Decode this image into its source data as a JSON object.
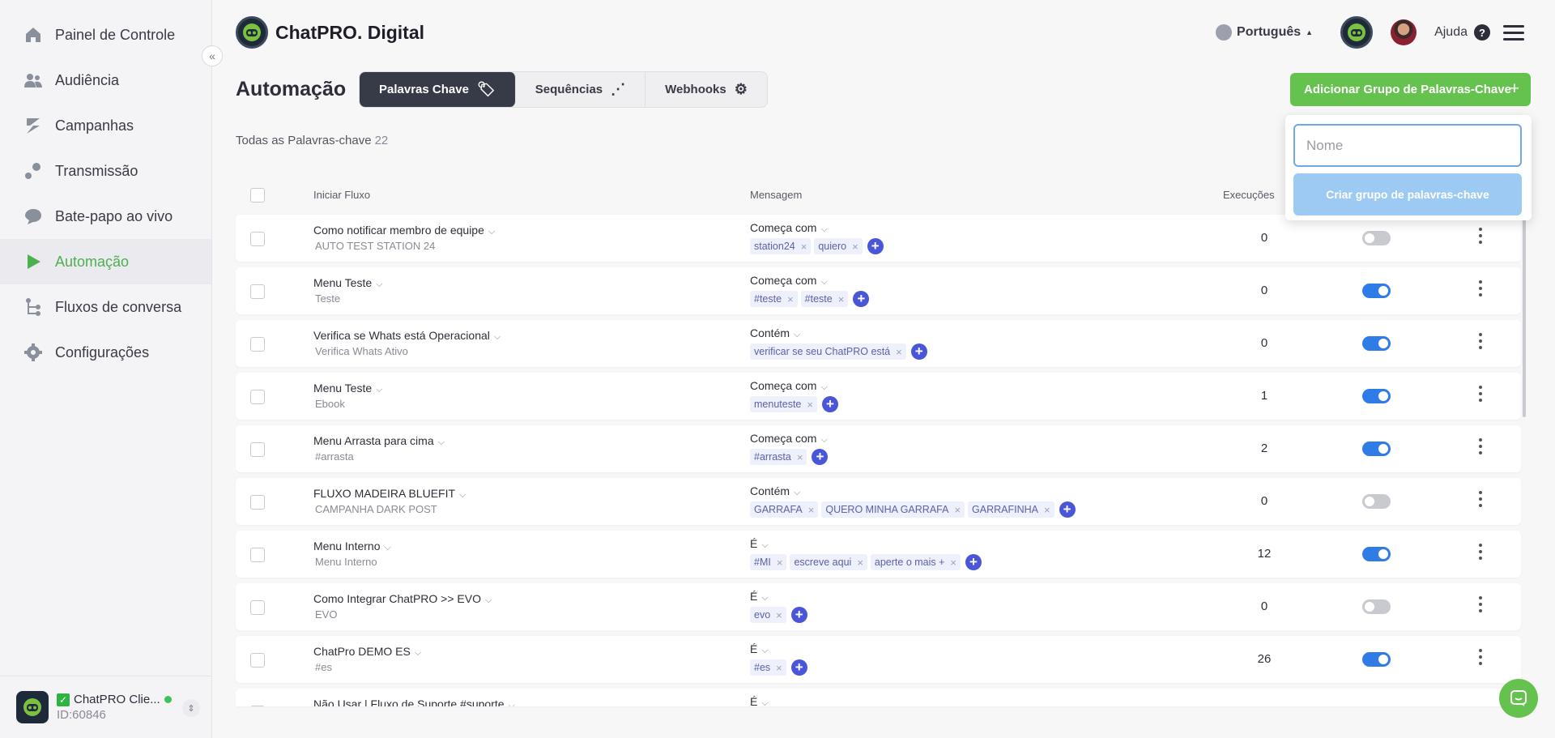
{
  "sidebar": {
    "items": [
      {
        "label": "Painel de Controle",
        "icon": "home-icon"
      },
      {
        "label": "Audiência",
        "icon": "users-icon"
      },
      {
        "label": "Campanhas",
        "icon": "campaigns-icon"
      },
      {
        "label": "Transmissão",
        "icon": "broadcast-icon"
      },
      {
        "label": "Bate-papo ao vivo",
        "icon": "chat-bubble-icon"
      },
      {
        "label": "Automação",
        "icon": "play-icon",
        "active": true
      },
      {
        "label": "Fluxos de conversa",
        "icon": "flow-icon"
      },
      {
        "label": "Configurações",
        "icon": "gear-icon"
      }
    ],
    "collapse_glyph": "«",
    "account": {
      "name": "ChatPRO Clie...",
      "id": "ID:60846",
      "check": "✓"
    }
  },
  "header": {
    "brand": "ChatPRO. Digital",
    "language": "Português",
    "help": "Ajuda",
    "help_glyph": "?"
  },
  "page": {
    "title": "Automação",
    "tabs": [
      {
        "label": "Palavras Chave",
        "icon": "tag-icon",
        "active": true
      },
      {
        "label": "Sequências",
        "icon": "sequence-icon"
      },
      {
        "label": "Webhooks",
        "icon": "webhook-icon"
      }
    ],
    "add_button": "Adicionar Grupo de Palavras-Chave",
    "add_plus": "+",
    "all_keywords_label": "Todas as Palavras-chave",
    "all_keywords_count": "22"
  },
  "table": {
    "headers": {
      "flow": "Iniciar Fluxo",
      "message": "Mensagem",
      "executions": "Execuções"
    },
    "rows": [
      {
        "name": "Como notificar membro de equipe",
        "sub": "AUTO TEST STATION 24",
        "condition": "Começa com",
        "keywords": [
          "station24",
          "quiero"
        ],
        "executions": "0",
        "active": false
      },
      {
        "name": "Menu Teste",
        "sub": "Teste",
        "condition": "Começa com",
        "keywords": [
          "#teste",
          "#teste"
        ],
        "executions": "0",
        "active": true
      },
      {
        "name": "Verifica se Whats está Operacional",
        "sub": "Verifica Whats Ativo",
        "condition": "Contém",
        "keywords": [
          "verificar se seu ChatPRO está"
        ],
        "executions": "0",
        "active": true
      },
      {
        "name": "Menu Teste",
        "sub": "Ebook",
        "condition": "Começa com",
        "keywords": [
          "menuteste"
        ],
        "executions": "1",
        "active": true
      },
      {
        "name": "Menu Arrasta para cima",
        "sub": "#arrasta",
        "condition": "Começa com",
        "keywords": [
          "#arrasta"
        ],
        "executions": "2",
        "active": true
      },
      {
        "name": "FLUXO MADEIRA BLUEFIT",
        "sub": "CAMPANHA DARK POST",
        "condition": "Contém",
        "keywords": [
          "GARRAFA",
          "QUERO MINHA GARRAFA",
          "GARRAFINHA"
        ],
        "executions": "0",
        "active": false
      },
      {
        "name": "Menu Interno",
        "sub": "Menu Interno",
        "condition": "É",
        "keywords": [
          "#MI",
          "escreve aqui",
          "aperte o mais +"
        ],
        "executions": "12",
        "active": true
      },
      {
        "name": "Como Integrar ChatPRO >> EVO",
        "sub": "EVO",
        "condition": "É",
        "keywords": [
          "evo"
        ],
        "executions": "0",
        "active": false
      },
      {
        "name": "ChatPro DEMO ES",
        "sub": "#es",
        "condition": "É",
        "keywords": [
          "#es"
        ],
        "executions": "26",
        "active": true
      },
      {
        "name": "Não Usar | Fluxo de Suporte #suporte",
        "sub": "",
        "condition": "É",
        "keywords": [],
        "executions": "",
        "active": true
      }
    ],
    "remove_glyph": "×",
    "add_glyph": "+",
    "dropdown_glyph": "⌵"
  },
  "popover": {
    "input_placeholder": "Nome",
    "input_value": "",
    "create_button": "Criar grupo de palavras-chave"
  },
  "colors": {
    "accent_green": "#66c24e",
    "toggle_on": "#2f7ce6",
    "keyword_add": "#4a56d8"
  }
}
